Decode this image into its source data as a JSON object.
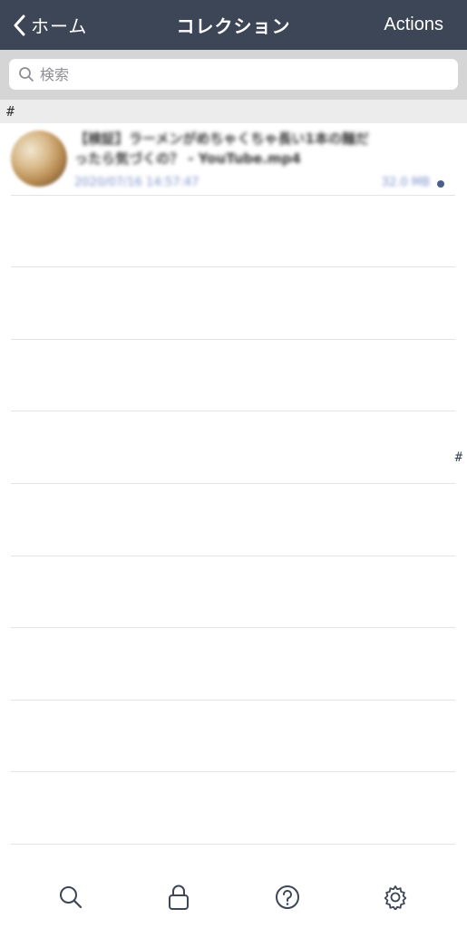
{
  "nav": {
    "back_label": "ホーム",
    "title": "コレクション",
    "actions_label": "Actions"
  },
  "search": {
    "placeholder": "検索"
  },
  "section": {
    "header": "#"
  },
  "items": [
    {
      "title": "【検証】ラーメンがめちゃくちゃ長い1本の麺だったら気づくの？ - YouTube.mp4",
      "date": "2020/07/16 14:57:47",
      "size": "32.0 MB"
    }
  ],
  "index": {
    "label": "#"
  },
  "tabbar": {
    "tabs": [
      "search-icon",
      "lock-icon",
      "help-icon",
      "gear-icon"
    ]
  },
  "colors": {
    "navbar": "#3d4656",
    "accent": "#4a5f8d"
  }
}
